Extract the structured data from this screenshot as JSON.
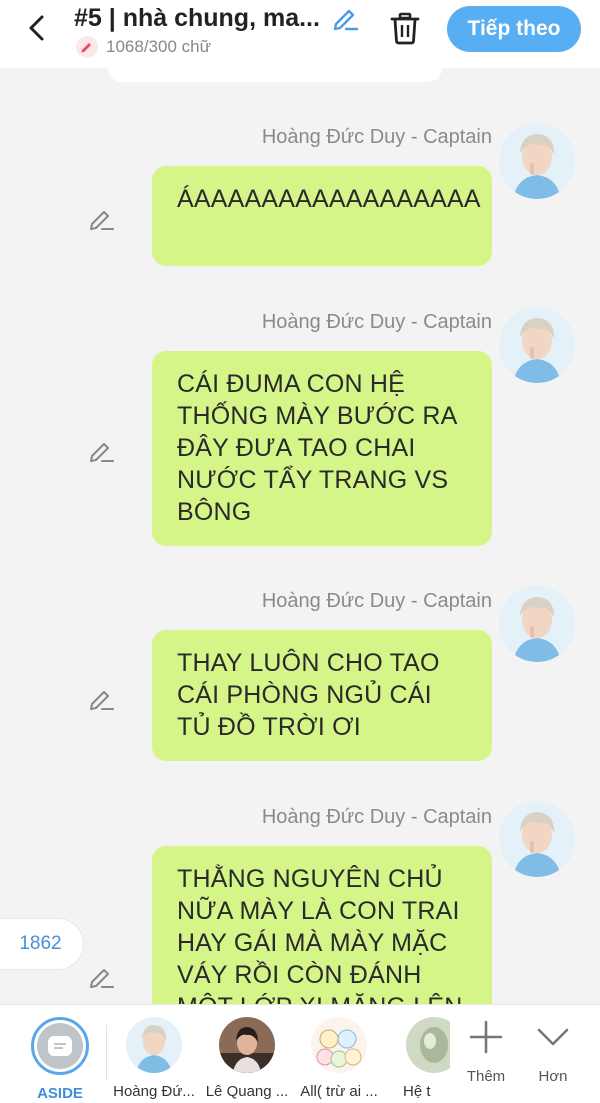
{
  "header": {
    "title": "#5 | nhà chung, ma...",
    "word_count": "1068/300 chữ",
    "next_label": "Tiếp theo"
  },
  "messages": [
    {
      "name": "Hoàng Đức Duy - Captain",
      "text": "ÁAAAAAAAAAAAAAAAAA"
    },
    {
      "name": "Hoàng Đức Duy - Captain",
      "text": "CÁI ĐUMA CON HỆ THỐNG MÀY BƯỚC RA ĐÂY ĐƯA TAO CHAI NƯỚC TẨY TRANG VS BÔNG"
    },
    {
      "name": "Hoàng Đức Duy - Captain",
      "text": "THAY LUÔN CHO TAO CÁI PHÒNG NGỦ CÁI TỦ ĐỒ TRỜI ƠI"
    },
    {
      "name": "Hoàng Đức Duy - Captain",
      "text": "THẰNG NGUYÊN CHỦ NỮA MÀY LÀ CON TRAI HAY GÁI MÀ MÀY MẶC VÁY RỒI CÒN ĐÁNH MỘT LỚP XI MĂNG LÊN"
    }
  ],
  "counter": "1862",
  "bottom_bar": {
    "characters": [
      {
        "label": "ASIDE"
      },
      {
        "label": "Hoàng Đứ..."
      },
      {
        "label": "Lê Quang ..."
      },
      {
        "label": "All( trừ ai ..."
      },
      {
        "label": "Hệ t"
      }
    ],
    "add_label": "Thêm",
    "more_label": "Hơn"
  },
  "colors": {
    "accent": "#57aef3",
    "bubble": "#d6f589",
    "background": "#f3f3f3"
  },
  "icons": [
    "back-arrow-icon",
    "pencil-icon",
    "trash-icon",
    "edit-icon",
    "plus-icon",
    "chevron-down-icon"
  ]
}
